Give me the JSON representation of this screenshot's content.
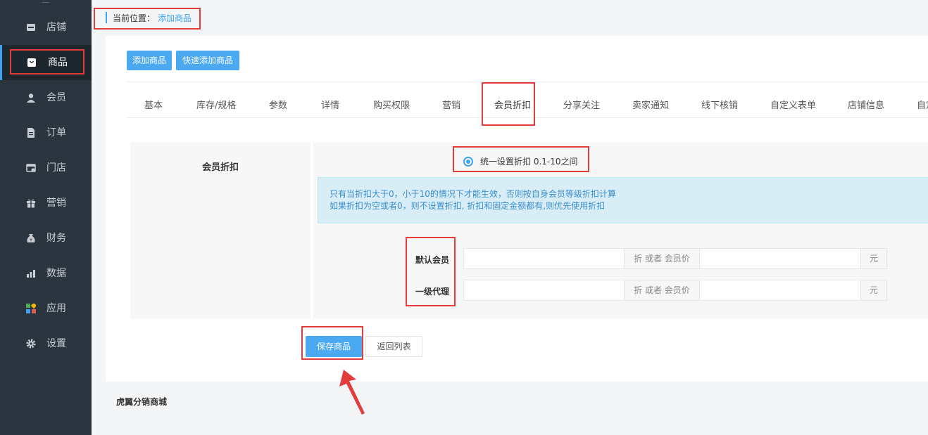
{
  "sidebar": {
    "items": [
      {
        "label": "店铺",
        "icon": "shop-icon",
        "active": false
      },
      {
        "label": "商品",
        "icon": "goods-bag-icon",
        "active": true
      },
      {
        "label": "会员",
        "icon": "user-icon",
        "active": false
      },
      {
        "label": "订单",
        "icon": "document-icon",
        "active": false
      },
      {
        "label": "门店",
        "icon": "store-icon",
        "active": false
      },
      {
        "label": "营销",
        "icon": "gift-icon",
        "active": false
      },
      {
        "label": "财务",
        "icon": "money-bag-icon",
        "active": false
      },
      {
        "label": "数据",
        "icon": "bar-chart-icon",
        "active": false
      },
      {
        "label": "应用",
        "icon": "apps-grid-icon",
        "active": false
      },
      {
        "label": "设置",
        "icon": "gear-icon",
        "active": false
      }
    ]
  },
  "breadcrumb": {
    "prefix": "当前位置：",
    "current": "添加商品"
  },
  "toolbar": {
    "add_label": "添加商品",
    "quick_add_label": "快速添加商品"
  },
  "tabs": [
    {
      "label": "基本"
    },
    {
      "label": "库存/规格"
    },
    {
      "label": "参数"
    },
    {
      "label": "详情"
    },
    {
      "label": "购买权限"
    },
    {
      "label": "营销"
    },
    {
      "label": "会员折扣",
      "active": true
    },
    {
      "label": "分享关注"
    },
    {
      "label": "卖家通知"
    },
    {
      "label": "线下核销"
    },
    {
      "label": "自定义表单"
    },
    {
      "label": "店铺信息"
    },
    {
      "label": "自定"
    }
  ],
  "form": {
    "section_label": "会员折扣",
    "radio_label": "统一设置折扣 0.1-10之间",
    "radio_checked": true,
    "notice_line1": "只有当折扣大于0，小于10的情况下才能生效，否则按自身会员等级折扣计算",
    "notice_line2": "如果折扣为空或者0，则不设置折扣, 折扣和固定金额都有,则优先使用折扣",
    "rows": [
      {
        "label": "默认会员",
        "discount_value": "",
        "addon_mid": "折 或者 会员价",
        "price_value": "",
        "addon_end": "元"
      },
      {
        "label": "一级代理",
        "discount_value": "",
        "addon_mid": "折 或者 会员价",
        "price_value": "",
        "addon_end": "元"
      }
    ]
  },
  "actions": {
    "save_label": "保存商品",
    "back_label": "返回列表"
  },
  "footer": {
    "text": "虎翼分销商城"
  },
  "colors": {
    "sidebar_bg": "#2b3540",
    "accent": "#3da2f0",
    "annotation": "#e23c3c"
  }
}
